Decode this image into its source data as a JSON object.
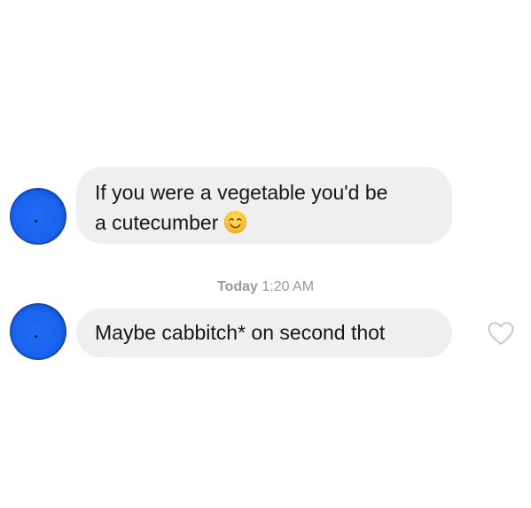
{
  "messages": [
    {
      "lines": [
        "If you were a vegetable you'd be",
        "a cutecumber"
      ],
      "emoji": "smiling-face-icon"
    },
    {
      "text": "Maybe cabbitch* on second thot",
      "reaction_icon": "heart-outline-icon"
    }
  ],
  "timestamp": {
    "day": "Today",
    "time": "1:20 AM"
  },
  "colors": {
    "bubble_background": "#efefef",
    "timestamp_text": "#9a9a9a",
    "avatar": "#1a63ee",
    "heart_outline": "#c9c9c9"
  }
}
